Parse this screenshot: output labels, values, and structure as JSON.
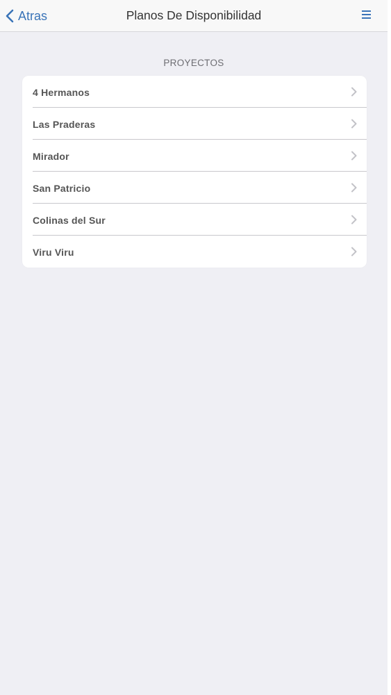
{
  "navbar": {
    "back_label": "Atras",
    "title": "Planos De Disponibilidad",
    "menu_icon": "hamburger-menu-icon",
    "accent_color": "#3a74b8"
  },
  "section": {
    "header": "PROYECTOS"
  },
  "projects": [
    {
      "label": "4 Hermanos"
    },
    {
      "label": "Las Praderas"
    },
    {
      "label": "Mirador"
    },
    {
      "label": "San Patricio"
    },
    {
      "label": "Colinas del Sur"
    },
    {
      "label": "Viru Viru"
    }
  ]
}
